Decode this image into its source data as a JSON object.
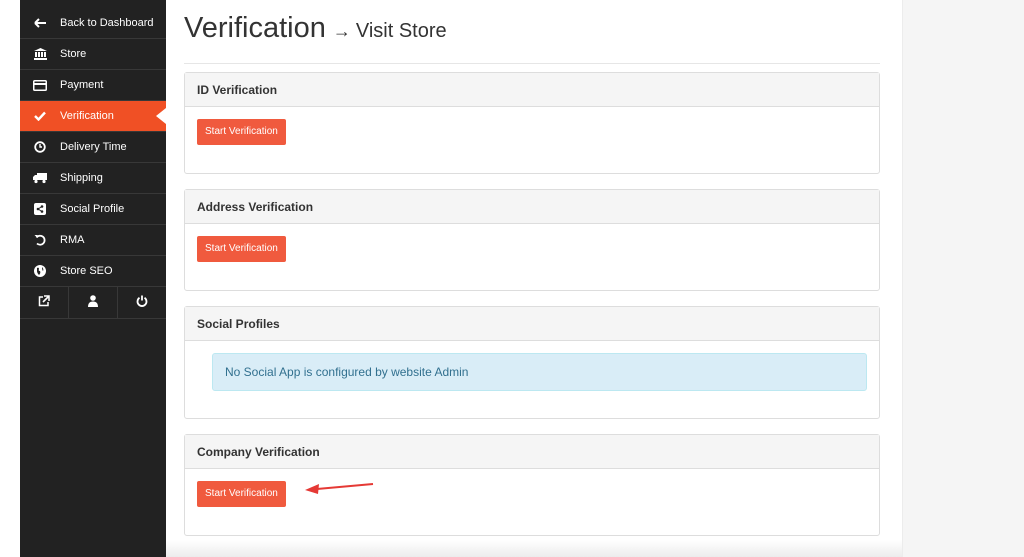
{
  "sidebar": {
    "items": [
      {
        "label": "Back to Dashboard",
        "icon": "arrow-left-icon",
        "active": false
      },
      {
        "label": "Store",
        "icon": "bank-icon",
        "active": false
      },
      {
        "label": "Payment",
        "icon": "credit-card-icon",
        "active": false
      },
      {
        "label": "Verification",
        "icon": "check-icon",
        "active": true
      },
      {
        "label": "Delivery Time",
        "icon": "clock-icon",
        "active": false
      },
      {
        "label": "Shipping",
        "icon": "truck-icon",
        "active": false
      },
      {
        "label": "Social Profile",
        "icon": "share-icon",
        "active": false
      },
      {
        "label": "RMA",
        "icon": "undo-icon",
        "active": false
      },
      {
        "label": "Store SEO",
        "icon": "globe-icon",
        "active": false
      }
    ],
    "footer": [
      {
        "icon": "external-link-icon"
      },
      {
        "icon": "user-icon"
      },
      {
        "icon": "power-icon"
      }
    ],
    "accent_color": "#f05025"
  },
  "header": {
    "title": "Verification",
    "arrow": "→",
    "link": "Visit Store"
  },
  "panels": [
    {
      "title": "ID Verification",
      "button": "Start Verification"
    },
    {
      "title": "Address Verification",
      "button": "Start Verification"
    },
    {
      "title": "Social Profiles",
      "alert": "No Social App is configured by website Admin"
    },
    {
      "title": "Company Verification",
      "button": "Start Verification"
    }
  ],
  "colors": {
    "button": "#f05a3e",
    "alert_bg": "#d9edf7",
    "annotation_arrow": "#e53935"
  }
}
